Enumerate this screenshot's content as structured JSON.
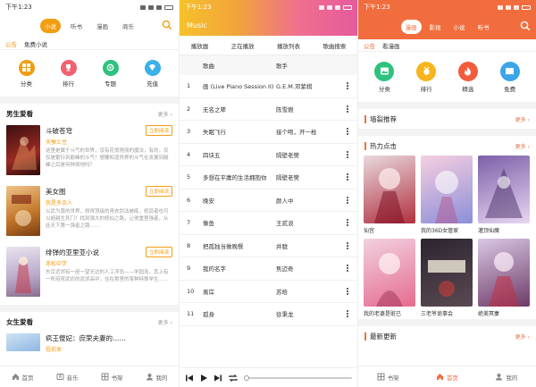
{
  "panel1": {
    "status": {
      "time": "下午1:23"
    },
    "tabs": [
      {
        "label": "小说",
        "active": true
      },
      {
        "label": "听书"
      },
      {
        "label": "漫画"
      },
      {
        "label": "商乐"
      }
    ],
    "notice": {
      "label": "公告",
      "text": "免费小说"
    },
    "categories": [
      {
        "label": "分类",
        "color": "#f39c12",
        "icon": "grid-icon"
      },
      {
        "label": "排行",
        "color": "#f06272",
        "icon": "trophy-icon"
      },
      {
        "label": "专题",
        "color": "#2ec27e",
        "icon": "topic-icon"
      },
      {
        "label": "充值",
        "color": "#3cb0e8",
        "icon": "diamond-icon"
      }
    ],
    "section1": {
      "title": "男生爱看",
      "more": "更多"
    },
    "books": [
      {
        "name": "斗破苍穹",
        "author": "天蚕土豆",
        "button": "立即阅读",
        "desc": "这里是属于斗气的世界，没有花俏艳丽的魔法，有的，仅仅是繁衍到巅峰的斗气！想要知道异界的斗气在发展到巅峰之后是何种境地吗？",
        "cover": "#7a1f1f"
      },
      {
        "name": "美女图",
        "author": "我是多余人",
        "button": "立即阅读",
        "desc": "以武为尊的世界，修得顶级的青衣剑法被练，修武者也可以超越生死门！找到强大的修仙之路，让他重登强者，从此天下第一强者之路……",
        "cover": "#d98a2b"
      },
      {
        "name": "绯弹的亚里亚小说",
        "author": "赤松中学",
        "button": "立即阅读",
        "desc": "东京近郊有一座一望无边的人工浮岛——学园岛，其上有一所培育武侦的武侦高中，住在那里的某种特殊学生……",
        "cover": "#c9c2d8"
      }
    ],
    "section2": {
      "title": "女生爱看",
      "more": "更多"
    },
    "book4": {
      "name": "疯王傻妃：庶荣夫妻的……",
      "author": "祖伯本"
    },
    "nav": [
      {
        "label": "首页",
        "icon": "home-icon"
      },
      {
        "label": "音乐",
        "icon": "music-icon"
      },
      {
        "label": "书架",
        "icon": "shelf-icon"
      },
      {
        "label": "我的",
        "icon": "user-icon"
      }
    ]
  },
  "panel2": {
    "status": {
      "time": "下午1:23"
    },
    "title": "Music",
    "tabs": [
      "播放器",
      "正在播放",
      "播放列表",
      "歌曲搜索"
    ],
    "columns": {
      "song": "歌曲",
      "artist": "歌手"
    },
    "songs": [
      {
        "n": "1",
        "title": "画 (Live Piano Session II)",
        "artist": "G.E.M.邓紫棋"
      },
      {
        "n": "2",
        "title": "无名之辈",
        "artist": "陈雪燃"
      },
      {
        "n": "3",
        "title": "失眠飞行",
        "artist": "接个吻，开一枪"
      },
      {
        "n": "4",
        "title": "四块五",
        "artist": "隔壁老樊"
      },
      {
        "n": "5",
        "title": "多想在平庸的生活拥抱你",
        "artist": "隔壁老樊"
      },
      {
        "n": "6",
        "title": "晚安",
        "artist": "颜人中"
      },
      {
        "n": "7",
        "title": "像鱼",
        "artist": "王贰浪"
      },
      {
        "n": "8",
        "title": "把孤独当做晚餐",
        "artist": "井胧"
      },
      {
        "n": "9",
        "title": "我的名字",
        "artist": "焦迈奇"
      },
      {
        "n": "10",
        "title": "离岸",
        "artist": "苏晗"
      },
      {
        "n": "11",
        "title": "孤身",
        "artist": "徐秉龙"
      }
    ]
  },
  "panel3": {
    "status": {
      "time": "下午1:23"
    },
    "tabs": [
      {
        "label": "漫画",
        "active": true
      },
      {
        "label": "影视"
      },
      {
        "label": "小说"
      },
      {
        "label": "听书"
      }
    ],
    "notice": {
      "label": "公告",
      "text": "看漫画"
    },
    "categories": [
      {
        "label": "分类",
        "color": "#2ec27e",
        "icon": "image-icon"
      },
      {
        "label": "排行",
        "color": "#f6b51e",
        "icon": "medal-icon"
      },
      {
        "label": "精选",
        "color": "#f25c3d",
        "icon": "flame-icon"
      },
      {
        "label": "免费",
        "color": "#3ba5e8",
        "icon": "book-icon"
      }
    ],
    "sec1": {
      "title": "墙裂推荐",
      "more": "更多"
    },
    "sec2": {
      "title": "热力点击",
      "more": "更多"
    },
    "sec3": {
      "title": "最新更新",
      "more": "更多"
    },
    "comics": [
      {
        "name": "仙宫",
        "c1": "#e9d9de",
        "c2": "#b0303e"
      },
      {
        "name": "我的36D女管家",
        "c1": "#f6cfe0",
        "c2": "#8c8fd8"
      },
      {
        "name": "灌顶仙魔",
        "c1": "#7d5fa8",
        "c2": "#e8d7f2"
      },
      {
        "name": "我的老婆是赃已",
        "c1": "#f2d1e0",
        "c2": "#e56c8f"
      },
      {
        "name": "三老爷诡事会",
        "c1": "#2c2430",
        "c2": "#e8e0d2"
      },
      {
        "name": "绝美冥妻",
        "c1": "#d9c7e6",
        "c2": "#6e3b66"
      }
    ],
    "nav": [
      {
        "label": "书架",
        "icon": "shelf-icon"
      },
      {
        "label": "首页",
        "icon": "home-icon",
        "active": true
      },
      {
        "label": "我的",
        "icon": "user-icon"
      }
    ]
  }
}
